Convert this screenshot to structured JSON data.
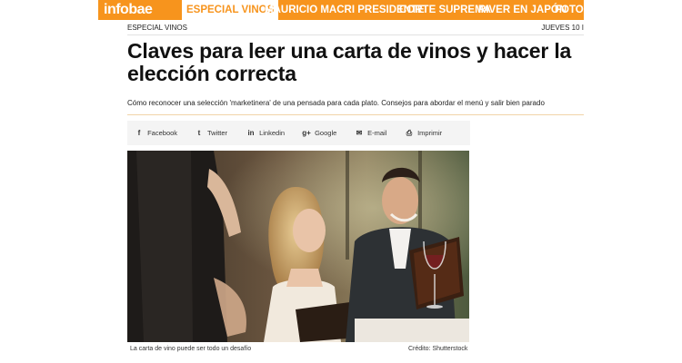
{
  "brand": "infobae",
  "nav": [
    "ESPECIAL VINOS",
    "MAURICIO MACRI PRESIDENTE",
    "CORTE SUPREMA",
    "RIVER EN JAPÓN",
    "FOTOS"
  ],
  "section": "ESPECIAL VINOS",
  "date": "JUEVES 10 I",
  "article": {
    "title": "Claves para leer una carta de vinos y hacer la elección correcta",
    "subtitle": "Cómo reconocer una selección 'marketinera' de una pensada para cada plato. Consejos para abordar el menú y salir bien parado"
  },
  "share": [
    {
      "label": "Facebook",
      "icon": "facebook-icon",
      "glyph": "f"
    },
    {
      "label": "Twitter",
      "icon": "twitter-icon",
      "glyph": "t"
    },
    {
      "label": "Linkedin",
      "icon": "linkedin-icon",
      "glyph": "in"
    },
    {
      "label": "Google",
      "icon": "google-plus-icon",
      "glyph": "g+"
    },
    {
      "label": "E-mail",
      "icon": "email-icon",
      "glyph": "✉"
    },
    {
      "label": "Imprimir",
      "icon": "print-icon",
      "glyph": "⎙"
    }
  ],
  "photo": {
    "caption": "La carta de vino puede ser todo un desafío",
    "credit": "Crédito: Shutterstock"
  },
  "colors": {
    "brand": "#f7941d",
    "share_bg": "#f4f4f4"
  }
}
